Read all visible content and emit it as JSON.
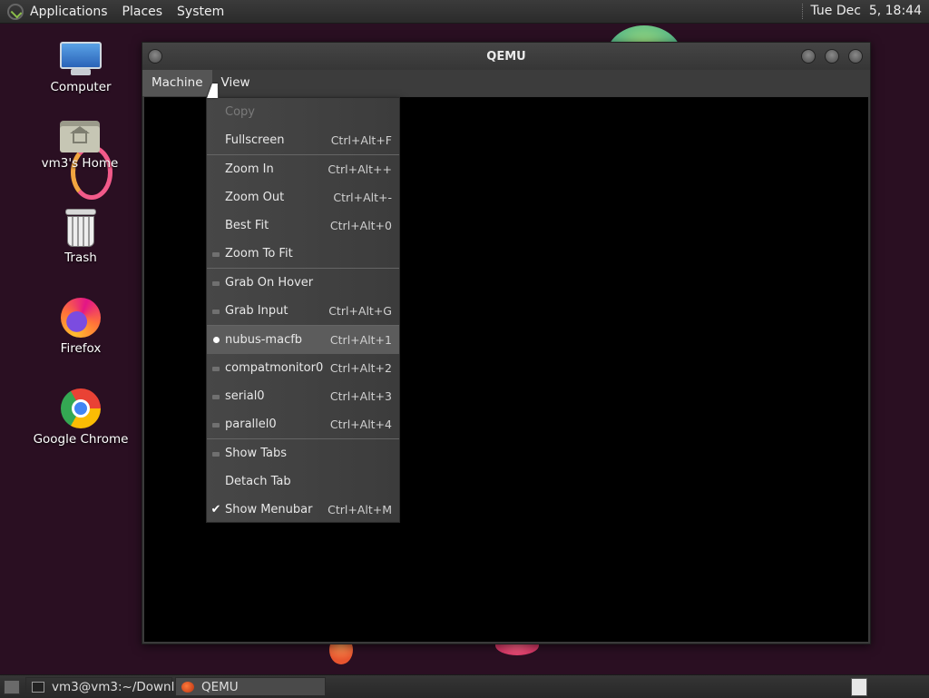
{
  "top_panel": {
    "menus": [
      "Applications",
      "Places",
      "System"
    ],
    "clock": "Tue Dec  5, 18:44"
  },
  "desktop_icons": [
    {
      "label": "Computer",
      "icon": "computer-icon"
    },
    {
      "label": "vm3's Home",
      "icon": "home-folder-icon"
    },
    {
      "label": "Trash",
      "icon": "trash-icon"
    },
    {
      "label": "Firefox",
      "icon": "firefox-icon"
    },
    {
      "label": "Google Chrome",
      "icon": "chrome-icon"
    }
  ],
  "window": {
    "title": "QEMU",
    "menubar": [
      "Machine",
      "View"
    ]
  },
  "view_menu": {
    "items": [
      {
        "label": "Copy",
        "shortcut": "",
        "indicator": "none",
        "disabled": true
      },
      {
        "label": "Fullscreen",
        "shortcut": "Ctrl+Alt+F",
        "indicator": "none"
      },
      {
        "label": "Zoom In",
        "shortcut": "Ctrl+Alt++",
        "indicator": "none"
      },
      {
        "label": "Zoom Out",
        "shortcut": "Ctrl+Alt+-",
        "indicator": "none"
      },
      {
        "label": "Best Fit",
        "shortcut": "Ctrl+Alt+0",
        "indicator": "none"
      },
      {
        "label": "Zoom To Fit",
        "shortcut": "",
        "indicator": "check-off"
      },
      {
        "label": "Grab On Hover",
        "shortcut": "",
        "indicator": "check-off"
      },
      {
        "label": "Grab Input",
        "shortcut": "Ctrl+Alt+G",
        "indicator": "check-off"
      },
      {
        "label": "nubus-macfb",
        "shortcut": "Ctrl+Alt+1",
        "indicator": "radio-on",
        "highlighted": true
      },
      {
        "label": "compatmonitor0",
        "shortcut": "Ctrl+Alt+2",
        "indicator": "radio-off"
      },
      {
        "label": "serial0",
        "shortcut": "Ctrl+Alt+3",
        "indicator": "radio-off"
      },
      {
        "label": "parallel0",
        "shortcut": "Ctrl+Alt+4",
        "indicator": "radio-off"
      },
      {
        "label": "Show Tabs",
        "shortcut": "",
        "indicator": "check-off"
      },
      {
        "label": "Detach Tab",
        "shortcut": "",
        "indicator": "none"
      },
      {
        "label": "Show Menubar",
        "shortcut": "Ctrl+Alt+M",
        "indicator": "check-on"
      }
    ]
  },
  "taskbar": {
    "tasks": [
      {
        "label": "vm3@vm3:~/Downl...",
        "icon": "terminal-icon",
        "active": false
      },
      {
        "label": "QEMU",
        "icon": "qemu-icon",
        "active": true
      }
    ]
  }
}
